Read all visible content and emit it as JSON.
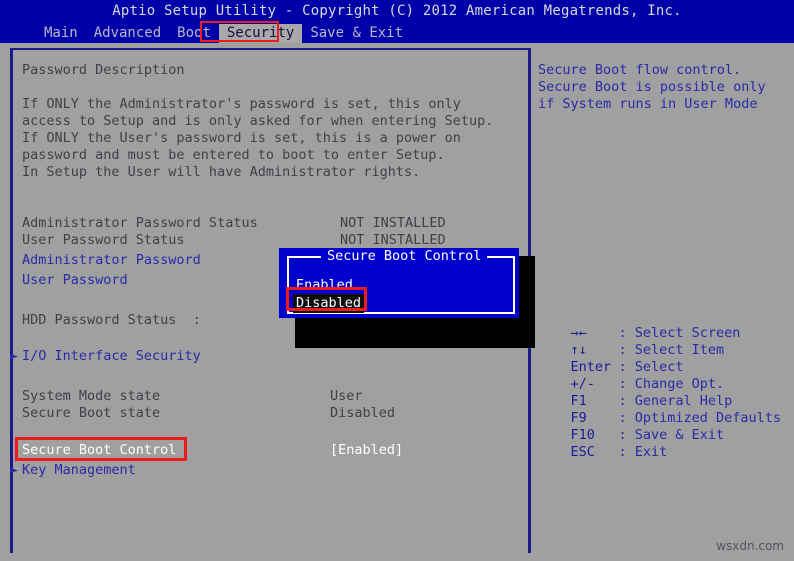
{
  "header": {
    "title": "Aptio Setup Utility - Copyright (C) 2012 American Megatrends, Inc.",
    "menu": [
      {
        "label": "Main",
        "active": false
      },
      {
        "label": "Advanced",
        "active": false
      },
      {
        "label": "Boot",
        "active": false
      },
      {
        "label": "Security",
        "active": true
      },
      {
        "label": "Save & Exit",
        "active": false
      }
    ]
  },
  "main": {
    "section_title": "Password Description",
    "description": [
      "If ONLY the Administrator's password is set, this only",
      "access to Setup and is only asked for when entering Setup.",
      "If ONLY the User's password is set, this is a power on",
      "password and must be entered to boot to enter Setup.",
      "In Setup the User will have Administrator rights."
    ],
    "rows": [
      {
        "label": "Administrator Password Status",
        "value": "NOT INSTALLED",
        "style": "plain"
      },
      {
        "label": "User Password Status",
        "value": "NOT INSTALLED",
        "style": "plain"
      },
      {
        "label": "Administrator Password",
        "value": "",
        "style": "link"
      },
      {
        "label": "User Password",
        "value": "",
        "style": "link"
      },
      {
        "label": "HDD Password Status  :",
        "value": "",
        "style": "plain"
      },
      {
        "label": "I/O Interface Security",
        "value": "",
        "style": "submenu"
      },
      {
        "label": "System Mode state",
        "value": "User",
        "style": "plain"
      },
      {
        "label": "Secure Boot state",
        "value": "Disabled",
        "style": "plain"
      },
      {
        "label": "Secure Boot Control",
        "value": "[Enabled]",
        "style": "selected"
      },
      {
        "label": "Key Management",
        "value": "",
        "style": "submenu"
      }
    ]
  },
  "dialog": {
    "title": "Secure Boot Control",
    "options": [
      {
        "label": "Enabled",
        "selected": false
      },
      {
        "label": "Disabled",
        "selected": true
      }
    ]
  },
  "help": {
    "lines": [
      "Secure Boot flow control.",
      "Secure Boot is possible only",
      "if System runs in User Mode"
    ]
  },
  "keys": [
    {
      "sym": "→←",
      "desc": ": Select Screen"
    },
    {
      "sym": "↑↓",
      "desc": ": Select Item"
    },
    {
      "sym": "Enter",
      "desc": ": Select"
    },
    {
      "sym": "+/-",
      "desc": ": Change Opt."
    },
    {
      "sym": "F1",
      "desc": ": General Help"
    },
    {
      "sym": "F9",
      "desc": ": Optimized Defaults"
    },
    {
      "sym": "F10",
      "desc": ": Save & Exit"
    },
    {
      "sym": "ESC",
      "desc": ": Exit"
    }
  ],
  "watermark": "wsxdn.com",
  "colors": {
    "screen_bg": "#a0a0a0",
    "header_bg": "#0000a8",
    "dialog_bg": "#0000cc",
    "border_blue": "#1a1a8c",
    "text_blue": "#2a2aa8",
    "text_dark": "#404048",
    "annotation_red": "#ee1c18"
  }
}
